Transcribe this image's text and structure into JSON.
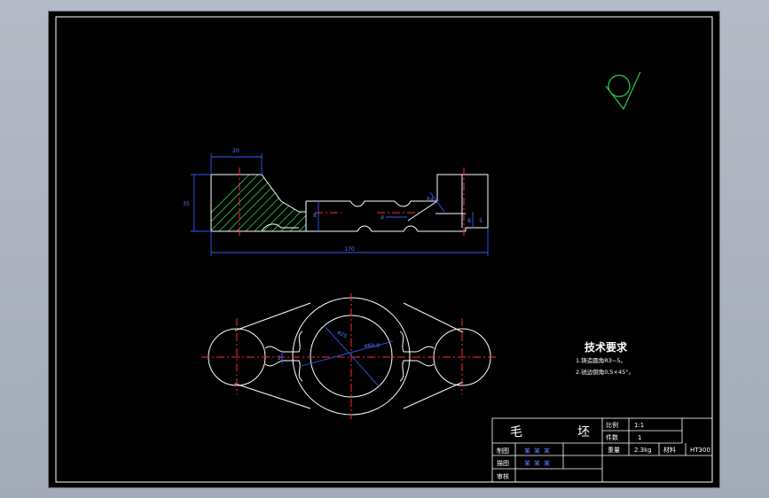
{
  "drawing": {
    "background": "#000000",
    "frame_color": "#ffffff",
    "dimension_color": "#2f5bff",
    "centerline_color": "#ff2a2a",
    "hatch_color": "#2ecc4a",
    "finish_symbol_color": "#2ecc4a"
  },
  "front_view": {
    "dim_top": "20",
    "dim_left_height": "35",
    "dim_overall": "170",
    "dim_small_left": "8",
    "dim_right_small": "8",
    "dim_phi": "ø",
    "dim_slant": "R4",
    "dim_right": "5"
  },
  "top_view": {
    "dim_center_diameter": "ø25",
    "dim_center_pcd": "ø60.0",
    "dim_left_small": "2"
  },
  "technical_requirements": {
    "title": "技术要求",
    "item1": "1.铸造圆角R3~5。",
    "item2": "2.锐边倒角0.5×45°。"
  },
  "title_block": {
    "part_name_1": "毛",
    "part_name_2": "坯",
    "scale_label": "比例",
    "scale_value": "1:1",
    "count_label": "件数",
    "count_value": "1",
    "weight_label": "重量",
    "weight_value": "2.3kg",
    "material_label": "材料",
    "material_value": "HT300",
    "drawn_label": "制图",
    "drawn_value": "某某某",
    "checked_label": "描图",
    "checked_value": "某某某",
    "review_label": "审核"
  }
}
